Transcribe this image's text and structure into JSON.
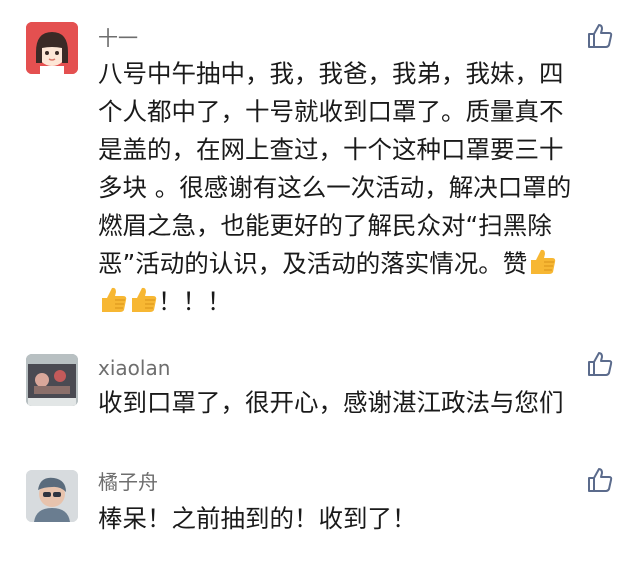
{
  "comments": [
    {
      "username": "十一",
      "lines": [
        "八号中午抽中，我，我爸，我弟，我妹，四",
        "个人都中了，十号就收到口罩了。质量真不",
        "是盖的，在网上查过，十个这种口罩要三十",
        "多块 。很感谢有这么一次活动，解决口罩的",
        "燃眉之急，也能更好的了解民众对“扫黑除",
        "恶”活动的认识，及活动的落实情况。赞"
      ],
      "last_line_tail": "！！！",
      "emoji": "thumbs-up-emoji"
    },
    {
      "username": "xiaolan",
      "lines": [
        "收到口罩了，很开心，感谢湛江政法与您们"
      ]
    },
    {
      "username": "橘子舟",
      "lines": [
        "棒呆！之前抽到的！收到了！"
      ]
    }
  ],
  "colors": {
    "username": "#6e6e6e",
    "text": "#1a1a1a",
    "like_icon": "#5b6b8c",
    "avatar1_bg": "#e45050",
    "emoji": "#f7b733"
  },
  "icons": {
    "like": "thumb-up-outline-icon"
  }
}
